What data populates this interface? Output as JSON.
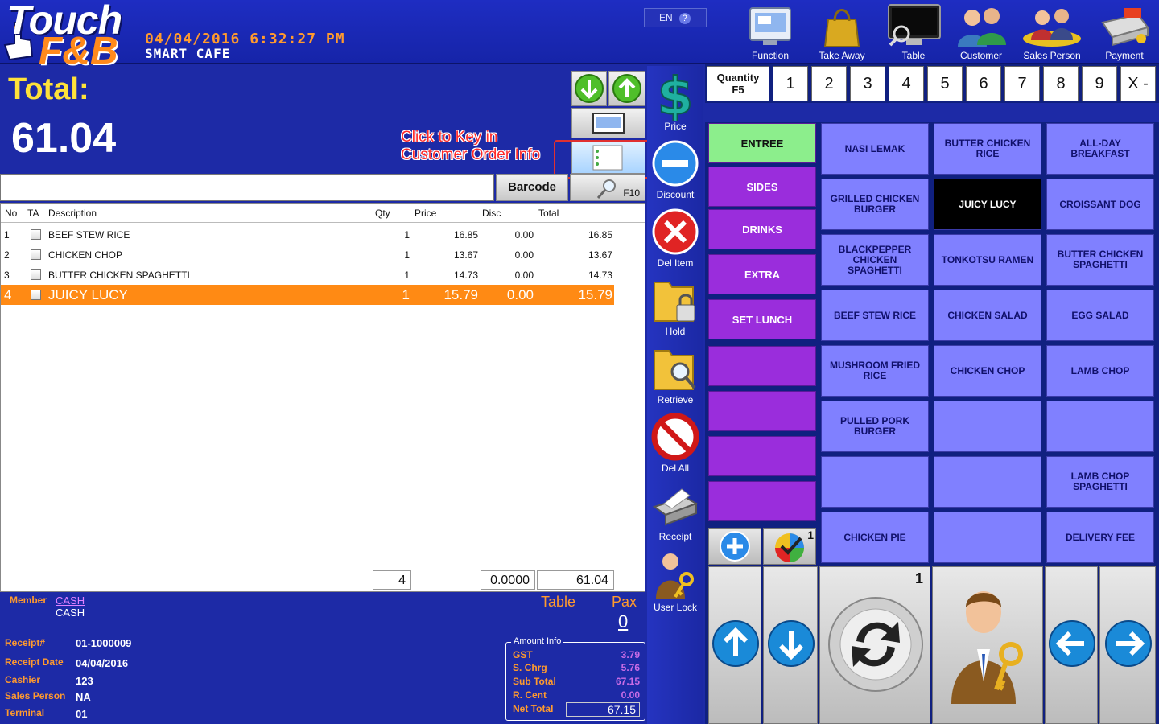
{
  "header": {
    "datetime": "04/04/2016 6:32:27 PM",
    "store_name": "SMART CAFE",
    "lang": "EN",
    "lang_help": "?",
    "buttons": [
      "Function",
      "Take Away",
      "Table",
      "Customer",
      "Sales Person",
      "Payment"
    ]
  },
  "totals": {
    "label": "Total:",
    "value": "61.04"
  },
  "annotation": {
    "line1": "Click to Key in",
    "line2": "Customer Order Info"
  },
  "scan": {
    "barcode_label": "Barcode",
    "f10_label": "F10"
  },
  "grid": {
    "headers": [
      "No",
      "TA",
      "Description",
      "Qty",
      "Price",
      "Disc",
      "Total"
    ],
    "rows": [
      {
        "no": "1",
        "desc": "BEEF STEW RICE",
        "qty": "1",
        "price": "16.85",
        "disc": "0.00",
        "total": "16.85"
      },
      {
        "no": "2",
        "desc": "CHICKEN CHOP",
        "qty": "1",
        "price": "13.67",
        "disc": "0.00",
        "total": "13.67"
      },
      {
        "no": "3",
        "desc": "BUTTER CHICKEN SPAGHETTI",
        "qty": "1",
        "price": "14.73",
        "disc": "0.00",
        "total": "14.73"
      },
      {
        "no": "4",
        "desc": "JUICY LUCY",
        "qty": "1",
        "price": "15.79",
        "disc": "0.00",
        "total": "15.79"
      }
    ],
    "footer": {
      "qty": "4",
      "disc": "0.0000",
      "total": "61.04"
    }
  },
  "info": {
    "member_label": "Member",
    "member_value": "CASH",
    "member_name": "CASH",
    "table_label": "Table",
    "pax_label": "Pax",
    "pax_value": "0",
    "receipt_label": "Receipt#",
    "receipt_value": "01-1000009",
    "receipt_date_label": "Receipt Date",
    "receipt_date_value": "04/04/2016",
    "cashier_label": "Cashier",
    "cashier_value": "123",
    "sales_label": "Sales Person",
    "sales_value": "NA",
    "terminal_label": "Terminal",
    "terminal_value": "01"
  },
  "amount": {
    "title": "Amount Info",
    "gst_label": "GST",
    "gst": "3.79",
    "schrg_label": "S. Chrg",
    "schrg": "5.76",
    "subtotal_label": "Sub Total",
    "subtotal": "67.15",
    "rcent_label": "R. Cent",
    "rcent": "0.00",
    "net_label": "Net Total",
    "net": "67.15"
  },
  "side": [
    "Price",
    "Discount",
    "Del Item",
    "Hold",
    "Retrieve",
    "Del All",
    "Receipt",
    "User Lock"
  ],
  "quantity": {
    "label_line1": "Quantity",
    "label_line2": "F5",
    "keys": [
      "1",
      "2",
      "3",
      "4",
      "5",
      "6",
      "7",
      "8",
      "9",
      "X -"
    ]
  },
  "categories": [
    "ENTREE",
    "SIDES",
    "DRINKS",
    "EXTRA",
    "SET LUNCH"
  ],
  "items": [
    "NASI LEMAK",
    "BUTTER CHICKEN RICE",
    "ALL-DAY BREAKFAST",
    "GRILLED CHICKEN BURGER",
    "JUICY LUCY",
    "CROISSANT DOG",
    "BLACKPEPPER CHICKEN SPAGHETTI",
    "TONKOTSU RAMEN",
    "BUTTER CHICKEN SPAGHETTI",
    "BEEF STEW RICE",
    "CHICKEN SALAD",
    "EGG SALAD",
    "MUSHROOM FRIED RICE",
    "CHICKEN CHOP",
    "LAMB CHOP",
    "PULLED PORK BURGER",
    "",
    "",
    "",
    "",
    "LAMB CHOP SPAGHETTI",
    "CHICKEN PIE",
    "",
    "DELIVERY FEE"
  ],
  "page_badge": "1",
  "check_badge": "1",
  "colors": {
    "background": "#1d2aa6",
    "selected_row": "#ff8a14",
    "category": "#9a2ddc",
    "category_active": "#8cee8c",
    "item": "#8080ff",
    "accent_orange": "#ff9a2e"
  }
}
